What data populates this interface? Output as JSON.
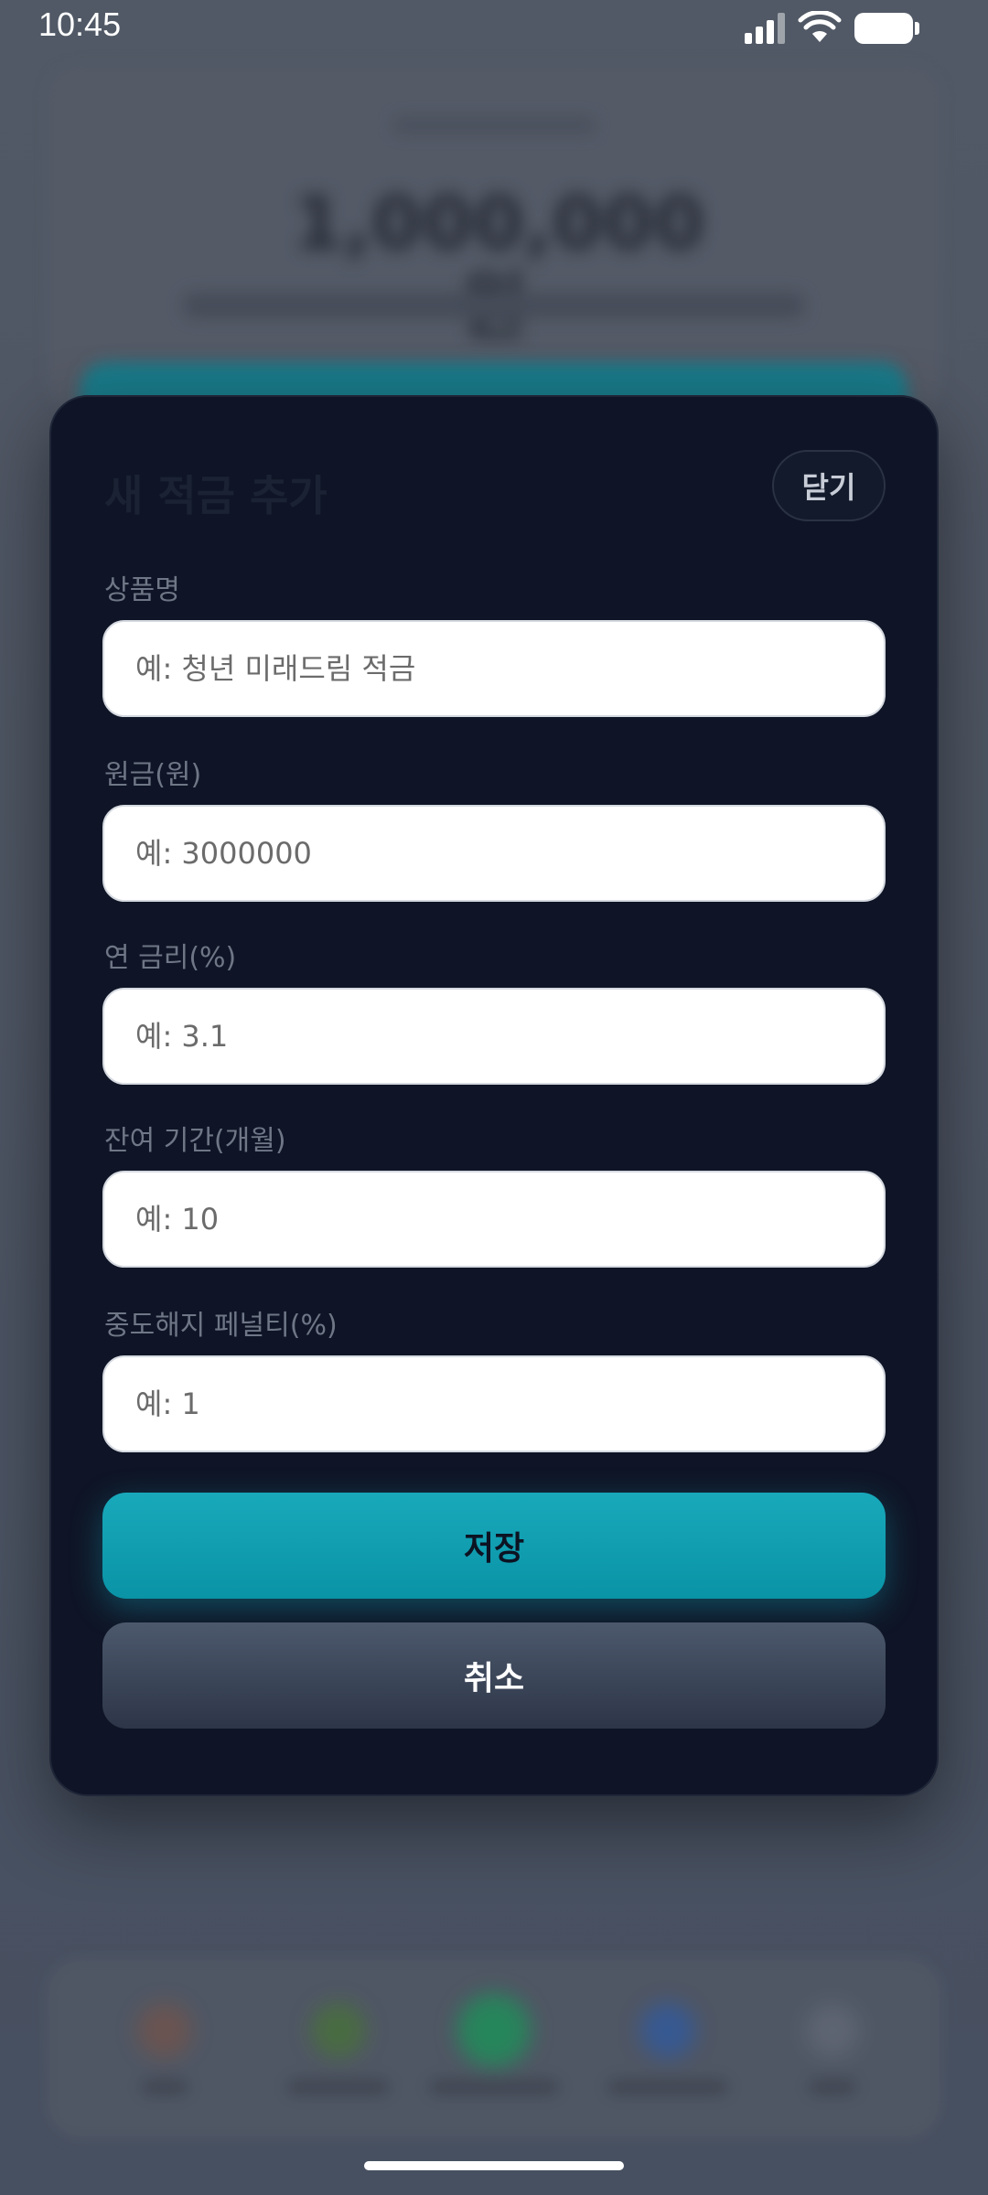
{
  "status_bar": {
    "time": "10:45"
  },
  "background": {
    "amount_text": "1,000,000원"
  },
  "modal": {
    "title": "새 적금 추가",
    "close_label": "닫기",
    "fields": [
      {
        "label": "상품명",
        "placeholder": "예: 청년 미래드림 적금"
      },
      {
        "label": "원금(원)",
        "placeholder": "예: 3000000"
      },
      {
        "label": "연 금리(%)",
        "placeholder": "예: 3.1"
      },
      {
        "label": "잔여 기간(개월)",
        "placeholder": "예: 10"
      },
      {
        "label": "중도해지 페널티(%)",
        "placeholder": "예: 1"
      }
    ],
    "save_label": "저장",
    "cancel_label": "취소"
  },
  "colors": {
    "modal_background": "#0f1526",
    "accent_teal": "#0a93a6",
    "cancel_button": "#2d3648"
  },
  "icons": {
    "signal": "signal-icon",
    "wifi": "wifi-icon",
    "battery": "battery-icon"
  }
}
